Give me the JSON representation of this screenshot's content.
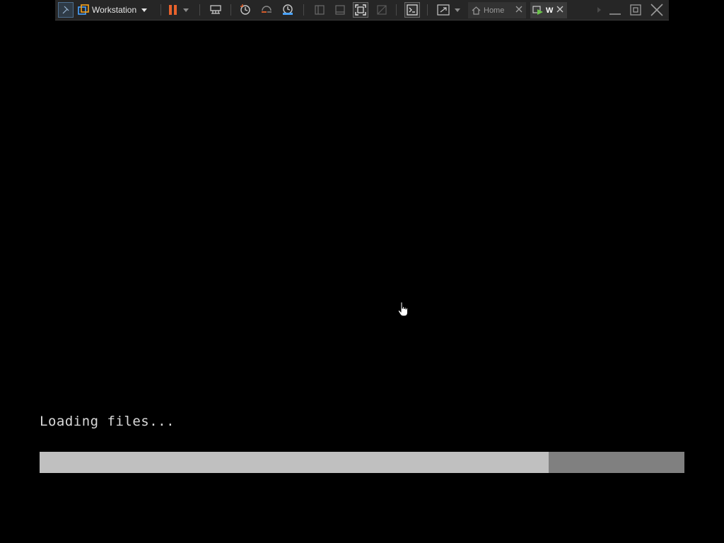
{
  "toolbar": {
    "product_label": "Workstation",
    "tabs": [
      {
        "label": "Home",
        "icon": "home-icon"
      },
      {
        "label": "W",
        "icon": "vm-running-icon"
      }
    ],
    "icons": [
      "pin-icon",
      "vm-logo-icon",
      "chevron-down-icon",
      "pause-icon",
      "send-ctrl-alt-del-icon",
      "snapshot-take-icon",
      "snapshot-revert-icon",
      "snapshot-manager-icon",
      "library-panel-icon",
      "thumbnail-bar-icon",
      "fullscreen-icon",
      "unity-icon",
      "console-icon",
      "stretch-guest-icon",
      "close-icon",
      "minimize-icon",
      "restore-icon"
    ],
    "colors": {
      "bar_bg": "#262626",
      "pause_accent": "#e8622c",
      "icon_fg": "#c8c8c8"
    }
  },
  "guest": {
    "status_text": "Loading files...",
    "progress_fraction": 0.789,
    "colors": {
      "background": "#000000",
      "progress_fill": "#c0c0c0",
      "progress_track": "#808080"
    }
  }
}
